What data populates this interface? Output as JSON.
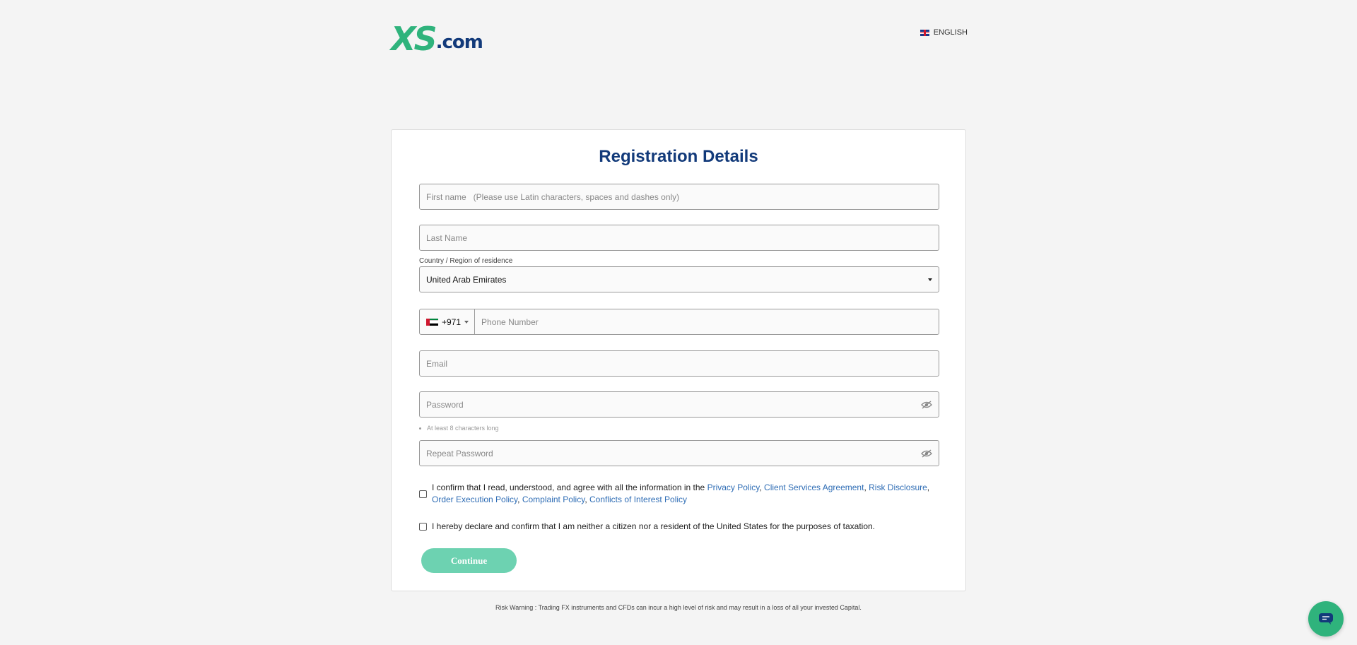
{
  "header": {
    "logo_xs": "XS",
    "logo_com": ".com",
    "language": "ENGLISH"
  },
  "form": {
    "title": "Registration Details",
    "first_name_placeholder": "First name   (Please use Latin characters, spaces and dashes only)",
    "last_name_placeholder": "Last Name",
    "country_label": "Country / Region of residence",
    "country_value": "United Arab Emirates",
    "phone_code": "+971",
    "phone_placeholder": "Phone Number",
    "email_placeholder": "Email",
    "password_placeholder": "Password",
    "password_hint": "At least 8 characters long",
    "repeat_password_placeholder": "Repeat Password",
    "confirm_text": "I confirm that I read, understood, and agree with all the information in the ",
    "links": {
      "privacy": "Privacy Policy",
      "csa": "Client Services Agreement",
      "risk": "Risk Disclosure",
      "order": "Order Execution Policy",
      "complaint": "Complaint Policy",
      "conflicts": "Conflicts of Interest Policy"
    },
    "us_declaration": "I hereby declare and confirm that I am neither a citizen nor a resident of the United States for the purposes of taxation.",
    "continue_label": "Continue"
  },
  "footer": {
    "risk_warning": "Risk Warning : Trading FX instruments and CFDs can incur a high level of risk and may result in a loss of all your invested Capital."
  },
  "colors": {
    "brand_green": "#2fb37c",
    "brand_navy": "#123a7a",
    "link": "#2f6db5",
    "button": "#6dd2b1"
  },
  "icons": {
    "language_flag": "uk-flag-icon",
    "phone_flag": "uae-flag-icon",
    "password_toggle": "eye-slash-icon",
    "chat": "chat-bubble-icon"
  }
}
